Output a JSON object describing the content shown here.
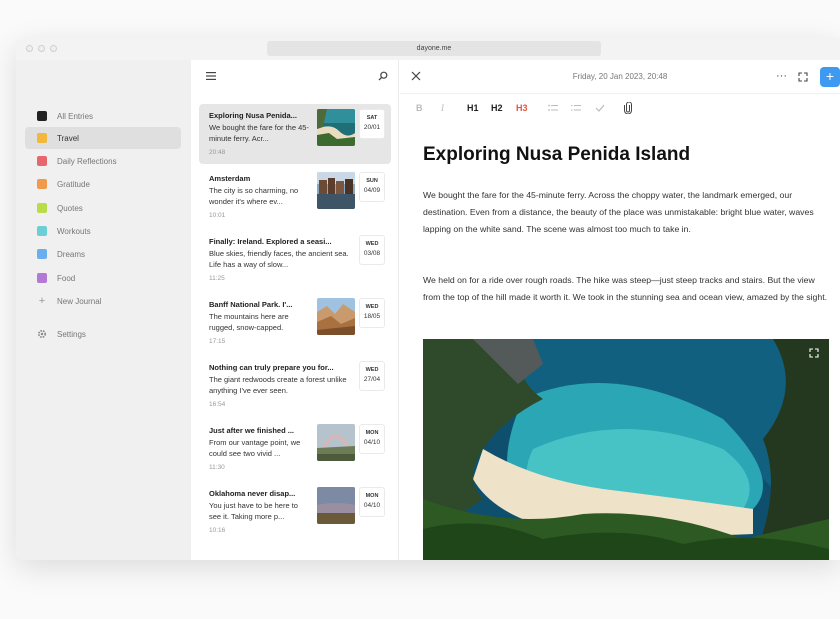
{
  "browser": {
    "url": "dayone.me"
  },
  "sidebar": {
    "journals": [
      {
        "label": "All Entries",
        "color": "#222222",
        "active": false
      },
      {
        "label": "Travel",
        "color": "#f3b73c",
        "active": true
      },
      {
        "label": "Daily Reflections",
        "color": "#e8666d",
        "active": false
      },
      {
        "label": "Gratitude",
        "color": "#f09a4a",
        "active": false
      },
      {
        "label": "Quotes",
        "color": "#b9dd4a",
        "active": false
      },
      {
        "label": "Workouts",
        "color": "#6ccfd6",
        "active": false
      },
      {
        "label": "Dreams",
        "color": "#6aaef0",
        "active": false
      },
      {
        "label": "Food",
        "color": "#b27ad6",
        "active": false
      }
    ],
    "new_journal": "New Journal",
    "settings": "Settings"
  },
  "entries": [
    {
      "title": "Exploring Nusa Penida...",
      "body": "We bought the fare for the 45-minute ferry. Acr...",
      "time": "20:48",
      "day": "SAT",
      "date": "20/01",
      "thumb": "beach",
      "selected": true
    },
    {
      "title": "Amsterdam",
      "body": "The city is so charming, no wonder it's where ev...",
      "time": "10:01",
      "day": "SUN",
      "date": "04/09",
      "thumb": "city",
      "selected": false
    },
    {
      "title": "Finally: Ireland. Explored a seasi...",
      "body": "Blue skies, friendly faces, the ancient sea. Life has a way of slow...",
      "time": "11:25",
      "day": "WED",
      "date": "03/08",
      "thumb": "",
      "selected": false
    },
    {
      "title": "Banff National Park. I'...",
      "body": "The mountains here are rugged, snow-capped.",
      "time": "17:15",
      "day": "WED",
      "date": "18/05",
      "thumb": "canyon",
      "selected": false
    },
    {
      "title": "Nothing can truly prepare you for...",
      "body": "The giant redwoods create a forest unlike anything I've ever seen.",
      "time": "16:54",
      "day": "WED",
      "date": "27/04",
      "thumb": "",
      "selected": false
    },
    {
      "title": "Just after we finished ...",
      "body": "From our vantage point, we could see two vivid ...",
      "time": "11:30",
      "day": "MON",
      "date": "04/10",
      "thumb": "rainbow",
      "selected": false
    },
    {
      "title": "Oklahoma never disap...",
      "body": "You just have to be here to see it. Taking more p...",
      "time": "10:16",
      "day": "MON",
      "date": "04/10",
      "thumb": "plains",
      "selected": false
    }
  ],
  "editor": {
    "date": "Friday, 20 Jan 2023, 20:48",
    "toolbar": {
      "bold": "B",
      "italic": "I",
      "h1": "H1",
      "h2": "H2",
      "h3": "H3"
    },
    "title": "Exploring Nusa Penida Island",
    "paragraphs": [
      "We bought the fare for the 45-minute ferry. Across the choppy water, the landmark emerged, our destination. Even from a distance, the beauty of the place was unmistakable: bright blue water, waves lapping on the white sand. The scene was almost too much to take in.",
      "We held on for a ride over rough roads. The hike was steep—just steep tracks and stairs. But the view from the top of the hill made it worth it. We took in the stunning sea and ocean view, amazed by the sight."
    ]
  },
  "icons": {
    "menu": "menu-icon",
    "search": "search-icon",
    "close": "close-icon",
    "more": "more-icon",
    "expand": "expand-icon",
    "add": "plus-icon",
    "settings": "gear-icon"
  },
  "colors": {
    "accent": "#3d9af0",
    "h3_active": "#e0573f"
  }
}
